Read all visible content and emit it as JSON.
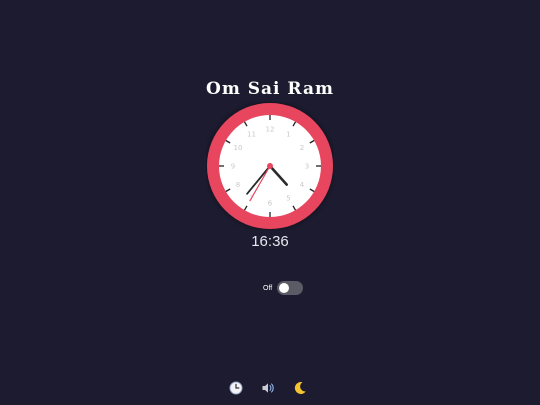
{
  "header": {
    "title": "Om Sai Ram"
  },
  "clock": {
    "time": "16:36",
    "hour": 16,
    "minute": 36,
    "second": 35,
    "numbers": [
      "12",
      "1",
      "2",
      "3",
      "4",
      "5",
      "6",
      "7",
      "8",
      "9",
      "10",
      "11"
    ],
    "colors": {
      "bezel": "#e8455e",
      "face": "#ffffff",
      "hands": "#2a2a2a",
      "second_hand": "#e8455e"
    }
  },
  "toggle": {
    "label": "Off",
    "state": "off"
  },
  "bottom_bar": {
    "icons": [
      "clock-icon",
      "speaker-icon",
      "moon-icon"
    ]
  }
}
